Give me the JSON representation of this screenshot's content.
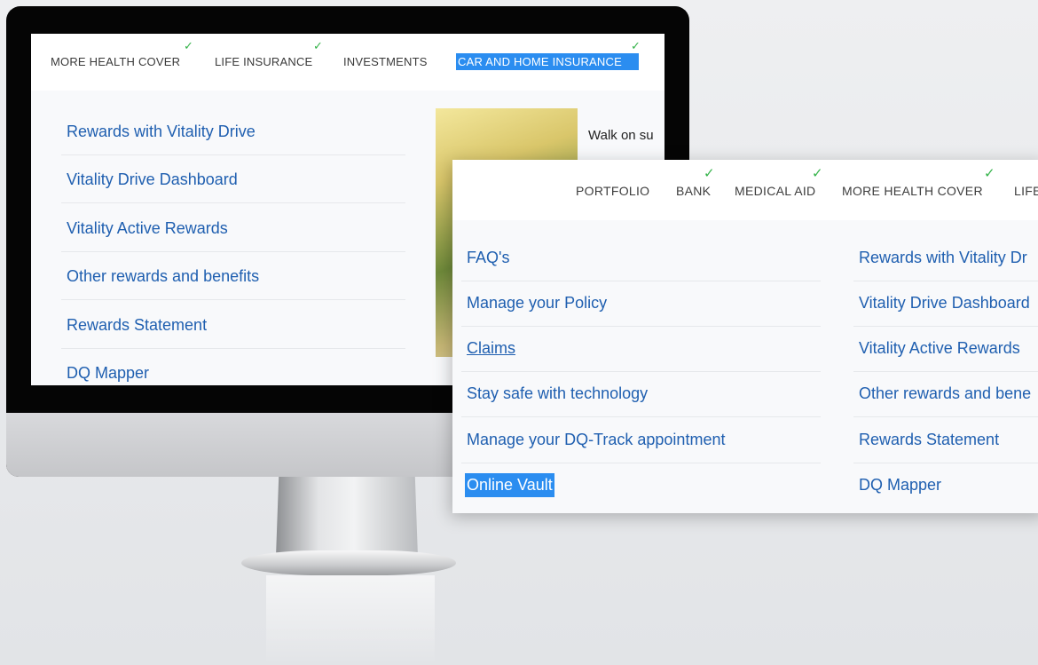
{
  "monitor_screen": {
    "tabs": [
      {
        "label": "MORE HEALTH COVER",
        "checked": true
      },
      {
        "label": "LIFE INSURANCE",
        "checked": true
      },
      {
        "label": "INVESTMENTS",
        "checked": false
      },
      {
        "label": "CAR AND HOME INSURANCE",
        "checked": true,
        "active": true
      }
    ],
    "menu_items": [
      "Rewards with Vitality Drive",
      "Vitality Drive Dashboard",
      "Vitality Active Rewards",
      "Other rewards and benefits",
      "Rewards Statement",
      "DQ Mapper"
    ],
    "promo_text": "Walk on su"
  },
  "panel": {
    "tabs": [
      {
        "label": "PORTFOLIO",
        "checked": false
      },
      {
        "label": "BANK",
        "checked": true
      },
      {
        "label": "MEDICAL AID",
        "checked": true
      },
      {
        "label": "MORE HEALTH COVER",
        "checked": true
      },
      {
        "label": "LIFE",
        "checked": false
      }
    ],
    "left_items": [
      "FAQ's",
      "Manage your Policy",
      "Claims",
      "Stay safe with technology",
      "Manage your DQ-Track appointment",
      "Online Vault"
    ],
    "right_items": [
      "Rewards with Vitality Dr",
      "Vitality Drive Dashboard",
      "Vitality Active Rewards",
      "Other rewards and bene",
      "Rewards Statement",
      "DQ Mapper"
    ],
    "check_glyph": "✓"
  },
  "colors": {
    "accent": "#2b8df0",
    "link": "#1f5fb0",
    "check": "#35b34a"
  }
}
